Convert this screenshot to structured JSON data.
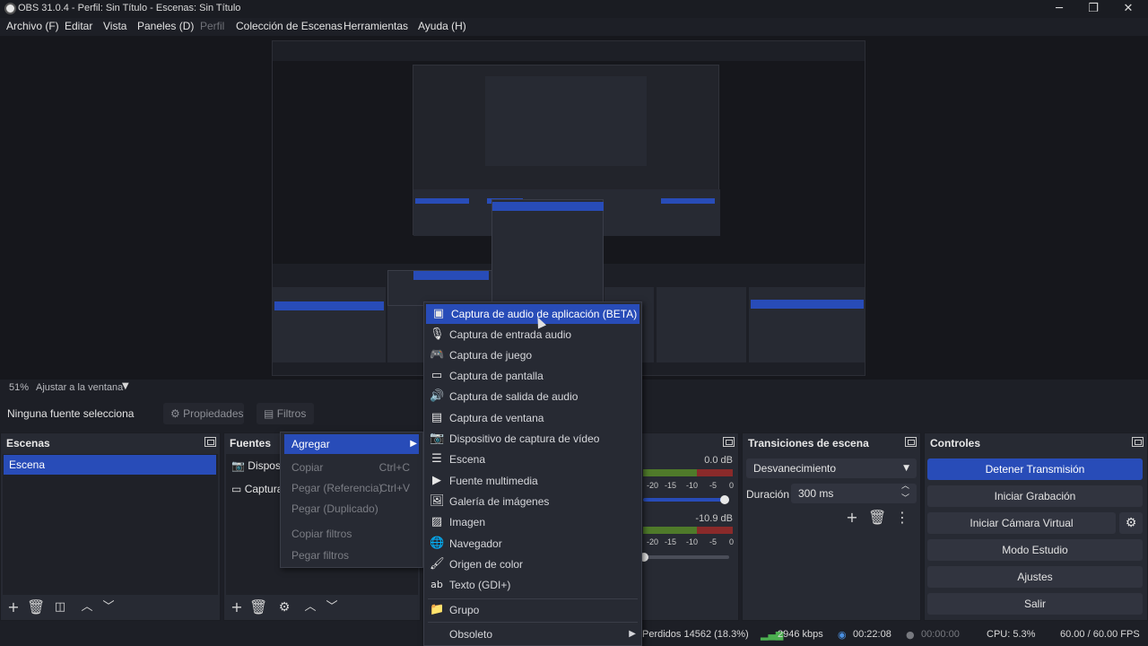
{
  "window": {
    "title": "OBS 31.0.4 - Perfil: Sin Título - Escenas: Sin Título",
    "minimize": "─",
    "maximize": "❐",
    "close": "✕"
  },
  "menu": [
    "Archivo (F)",
    "Editar",
    "Vista",
    "Paneles (D)",
    "Perfil",
    "Colección de Escenas",
    "Herramientas",
    "Ayuda (H)"
  ],
  "zoom": {
    "percent": "51%",
    "mode": "Ajustar a la ventana"
  },
  "props": {
    "no_source": "Ninguna fuente selecciona",
    "properties": "Propiedades",
    "filters": "Filtros"
  },
  "scenes": {
    "title": "Escenas",
    "items": [
      "Escena"
    ]
  },
  "sources": {
    "title": "Fuentes",
    "items": [
      "Disposit",
      "Captura"
    ]
  },
  "mixer": {
    "track1_db": "0.0 dB",
    "track2_db": "-10.9 dB",
    "ticks": [
      "-20",
      "-15",
      "-10",
      "-5",
      "0"
    ]
  },
  "transitions": {
    "title": "Transiciones de escena",
    "selected": "Desvanecimiento",
    "duration_label": "Duración",
    "duration_value": "300 ms"
  },
  "controls": {
    "title": "Controles",
    "buttons": [
      "Detener Transmisión",
      "Iniciar Grabación",
      "Iniciar Cámara Virtual",
      "Modo Estudio",
      "Ajustes",
      "Salir"
    ]
  },
  "status": {
    "dropped": "Perdidos 14562 (18.3%)",
    "bitrate": "2946 kbps",
    "stream_time": "00:22:08",
    "rec_time": "00:00:00",
    "cpu": "CPU: 5.3%",
    "fps": "60.00 / 60.00 FPS"
  },
  "edit_menu": {
    "add": "Agregar",
    "copy": "Copiar",
    "copy_sc": "Ctrl+C",
    "paste_ref": "Pegar (Referencia)",
    "paste_ref_sc": "Ctrl+V",
    "paste_dup": "Pegar (Duplicado)",
    "copy_filters": "Copiar filtros",
    "paste_filters": "Pegar filtros"
  },
  "add_menu": [
    {
      "label": "Captura de audio de aplicación (BETA)",
      "icon": "app-audio-icon"
    },
    {
      "label": "Captura de entrada audio",
      "icon": "microphone-icon"
    },
    {
      "label": "Captura de juego",
      "icon": "gamepad-icon"
    },
    {
      "label": "Captura de pantalla",
      "icon": "monitor-icon"
    },
    {
      "label": "Captura de salida de audio",
      "icon": "speaker-icon"
    },
    {
      "label": "Captura de ventana",
      "icon": "window-icon"
    },
    {
      "label": "Dispositivo de captura de vídeo",
      "icon": "camera-icon"
    },
    {
      "label": "Escena",
      "icon": "list-icon"
    },
    {
      "label": "Fuente multimedia",
      "icon": "play-icon"
    },
    {
      "label": "Galería de imágenes",
      "icon": "slideshow-icon"
    },
    {
      "label": "Imagen",
      "icon": "image-icon"
    },
    {
      "label": "Navegador",
      "icon": "globe-icon"
    },
    {
      "label": "Origen de color",
      "icon": "brush-icon"
    },
    {
      "label": "Texto (GDI+)",
      "icon": "text-icon"
    },
    {
      "label": "Grupo",
      "icon": "folder-icon"
    },
    {
      "label": "Obsoleto",
      "icon": ""
    }
  ]
}
